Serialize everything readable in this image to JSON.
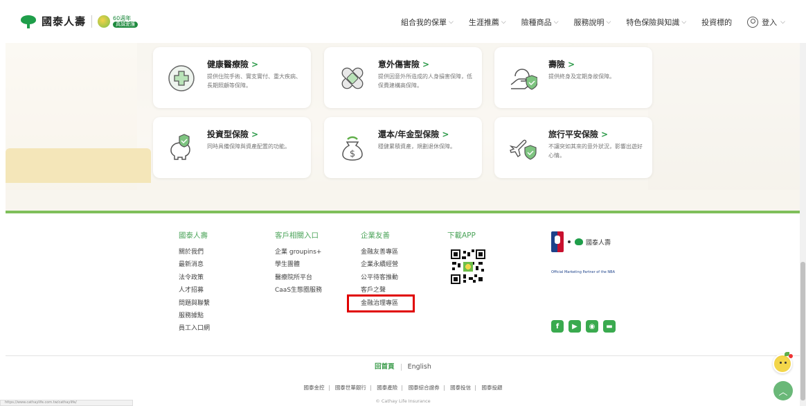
{
  "header": {
    "brand_name": "國泰人壽",
    "anniversary_top": "60週年",
    "anniversary_pill": "真誠愛護",
    "nav": [
      {
        "label": "組合我的保單"
      },
      {
        "label": "生涯推薦"
      },
      {
        "label": "險種商品"
      },
      {
        "label": "服務說明"
      },
      {
        "label": "特色保險與知識"
      },
      {
        "label": "投資標的"
      }
    ],
    "login_label": "登入"
  },
  "cards": [
    {
      "title": "健康醫療險",
      "desc": "提供住院手術、實支實付、重大疾病、長期照顧等保障。",
      "icon": "medical-cross-icon"
    },
    {
      "title": "意外傷害險",
      "desc": "提供因意外所造成的人身損害保障，低保費建構高保障。",
      "icon": "bandage-icon"
    },
    {
      "title": "壽險",
      "desc": "提供終身及定期身故保障。",
      "icon": "hand-shield-icon"
    },
    {
      "title": "投資型保險",
      "desc": "同時具備保障與資產配置的功能。",
      "icon": "piggy-bank-shield-icon"
    },
    {
      "title": "還本/年金型保險",
      "desc": "穩健累積資產，規劃退休保障。",
      "icon": "money-bag-icon"
    },
    {
      "title": "旅行平安保險",
      "desc": "不讓突如其來的意外狀況，影響出遊好心情。",
      "icon": "airplane-shield-icon"
    }
  ],
  "footer": {
    "col1": {
      "head": "國泰人壽",
      "links": [
        "關於我們",
        "最新消息",
        "法令政策",
        "人才招募",
        "問題與聯繫",
        "服務據點",
        "員工入口網"
      ]
    },
    "col2": {
      "head": "客戶相關入口",
      "links": [
        "企業 groupins+",
        "學生團體",
        "醫療院所平台",
        "CaaS生態圈服務"
      ]
    },
    "col3": {
      "head": "企業友善",
      "links": [
        "金融友善專區",
        "企業永續經營",
        "公平待客推動",
        "客戶之聲",
        "金融治理專區"
      ]
    },
    "col4": {
      "head": "下載APP"
    },
    "nba_brand": "國泰人壽",
    "nba_caption": "Official Marketing Partner of the NBA",
    "social": [
      {
        "icon": "facebook-icon",
        "glyph": "f"
      },
      {
        "icon": "youtube-icon",
        "glyph": "▶"
      },
      {
        "icon": "podcast-icon",
        "glyph": "◉"
      },
      {
        "icon": "line-icon",
        "glyph": "▬"
      }
    ],
    "lang_current": "回首頁",
    "lang_other": "English",
    "subsidiaries": [
      "國泰金控",
      "國泰世華銀行",
      "國泰產險",
      "國泰綜合證券",
      "國泰投信",
      "國泰投顧"
    ],
    "copyright": "© Cathay Life Insurance",
    "status_url": "https://www.cathaylife.com.tw/cathaylife/"
  },
  "colors": {
    "brand_green": "#1f9e4a",
    "accent_green": "#3aaa4f",
    "highlight": "#e00000"
  }
}
